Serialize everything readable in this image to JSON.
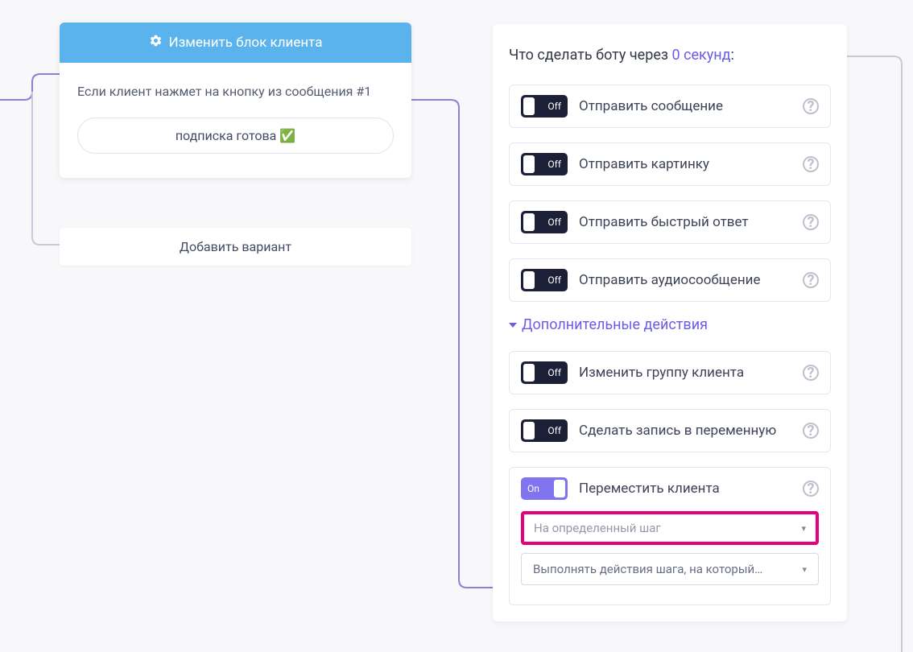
{
  "client_block": {
    "header": "Изменить блок клиента",
    "condition": "Если клиент нажмет на кнопку из сообщения #1",
    "option": "подписка готова ✅"
  },
  "add_variant": "Добавить вариант",
  "panel": {
    "title_prefix": "Что сделать боту через ",
    "delay": "0 секунд",
    "title_suffix": ":"
  },
  "actions": {
    "send_message": {
      "label": "Отправить сообщение",
      "state": "Off"
    },
    "send_image": {
      "label": "Отправить картинку",
      "state": "Off"
    },
    "send_quick_reply": {
      "label": "Отправить быстрый ответ",
      "state": "Off"
    },
    "send_audio": {
      "label": "Отправить аудиосообщение",
      "state": "Off"
    }
  },
  "extra_header": "Дополнительные действия",
  "extra_actions": {
    "change_group": {
      "label": "Изменить группу клиента",
      "state": "Off"
    },
    "set_variable": {
      "label": "Сделать запись в переменную",
      "state": "Off"
    },
    "move_client": {
      "label": "Переместить клиента",
      "state": "On"
    }
  },
  "selects": {
    "step_select": "На определенный шаг",
    "execute_select": "Выполнять действия шага, на который…"
  }
}
